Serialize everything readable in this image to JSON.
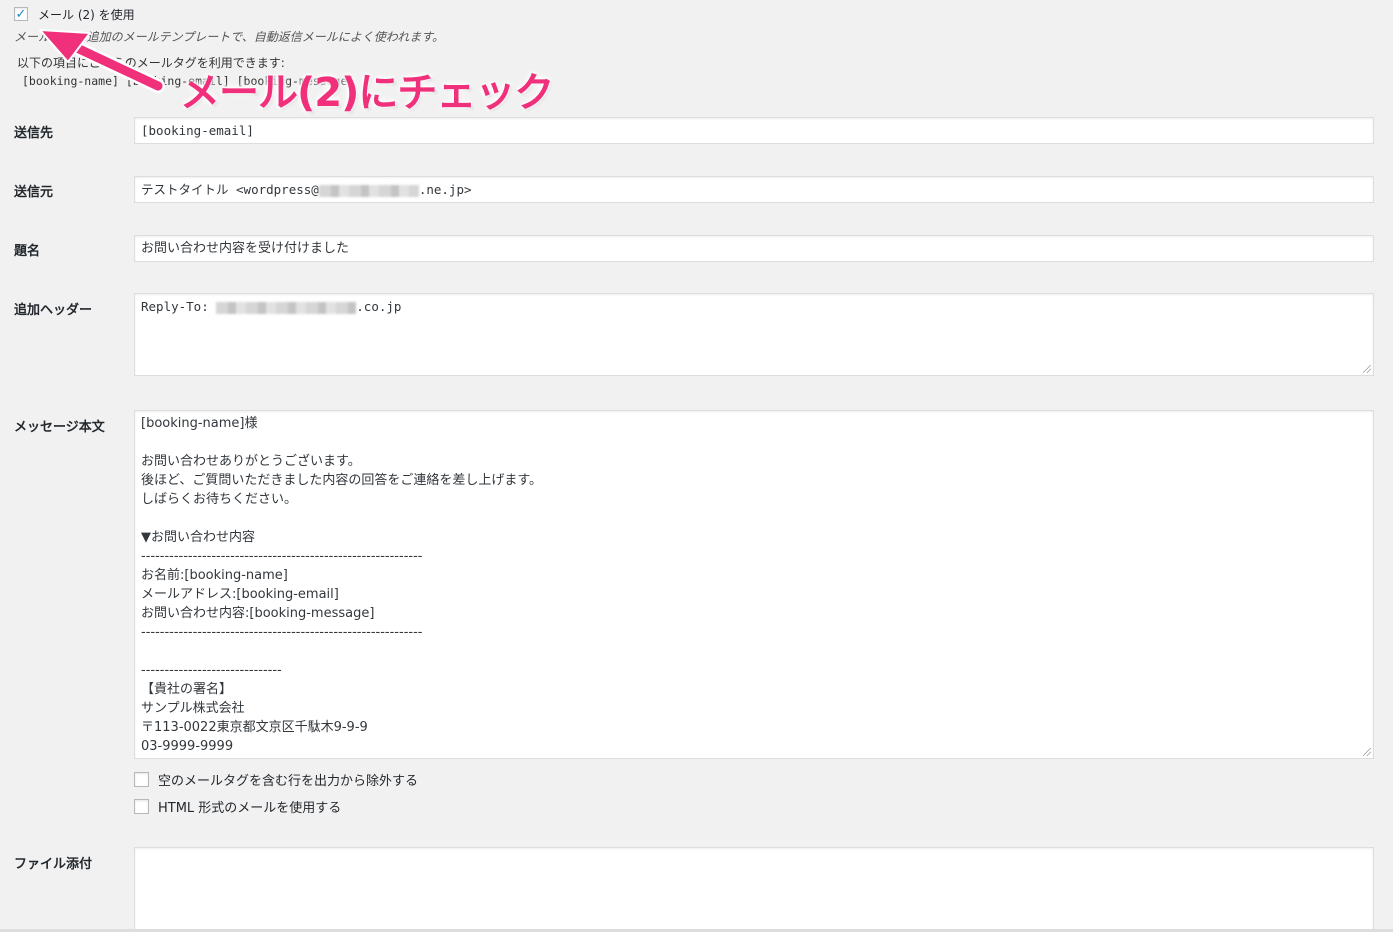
{
  "mail2": {
    "use_label": "メール (2) を使用",
    "use_checked": true,
    "description": "メール (2) は追加のメールテンプレートで、自動返信メールによく使われます。",
    "tags_intro": "以下の項目にこれらのメールタグを利用できます:",
    "tags_line": "[booking-name] [booking-email] [booking-message]"
  },
  "annotation": {
    "text": "メール(2)にチェック",
    "color": "#f0307a"
  },
  "fields": {
    "to": {
      "label": "送信先",
      "value": "[booking-email]"
    },
    "from": {
      "label": "送信元",
      "value_prefix": "テストタイトル <wordpress@",
      "value_suffix": ".ne.jp>"
    },
    "subject": {
      "label": "題名",
      "value": "お問い合わせ内容を受け付けました"
    },
    "headers": {
      "label": "追加ヘッダー",
      "value_prefix": "Reply-To: ",
      "value_suffix": ".co.jp"
    },
    "body": {
      "label": "メッセージ本文",
      "value": "[booking-name]様\n\nお問い合わせありがとうございます。\n後ほど、ご質問いただきました内容の回答をご連絡を差し上げます。\nしばらくお待ちください。\n\n▼お問い合わせ内容\n------------------------------------------------------------\nお名前:[booking-name]\nメールアドレス:[booking-email]\nお問い合わせ内容:[booking-message]\n------------------------------------------------------------\n\n------------------------------\n【貴社の署名】\nサンプル株式会社\n〒113-0022東京都文京区千駄木9-9-9\n03-9999-9999"
    },
    "attachments": {
      "label": "ファイル添付",
      "value": ""
    }
  },
  "options": {
    "exclude_blank": {
      "label": "空のメールタグを含む行を出力から除外する",
      "checked": false
    },
    "use_html": {
      "label": "HTML 形式のメールを使用する",
      "checked": false
    }
  },
  "colors": {
    "checkmark": "#1e8cbe",
    "background": "#f1f1f1"
  }
}
